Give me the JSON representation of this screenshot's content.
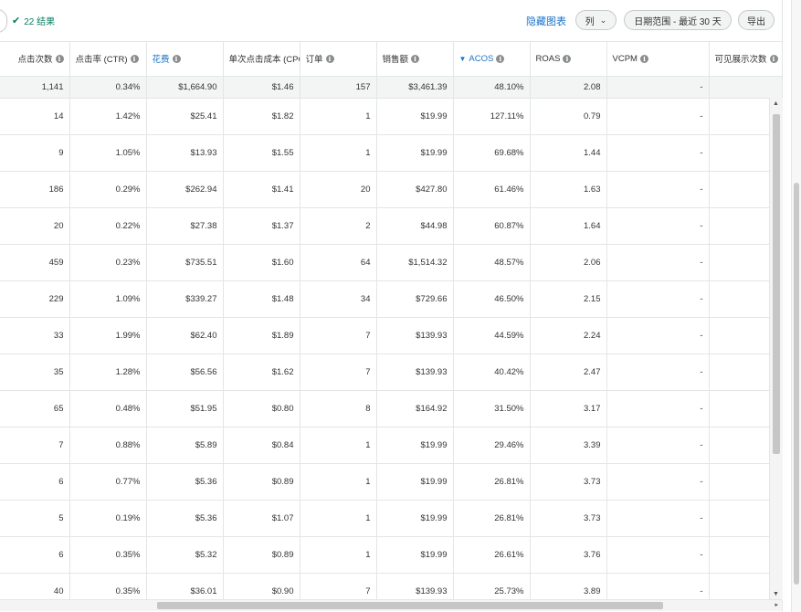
{
  "toolbar": {
    "results_text": "22 结果",
    "hide_chart": "隐藏图表",
    "columns_label": "列",
    "date_range_label": "日期范围 - 最近 30 天",
    "export_label": "导出"
  },
  "columns": [
    {
      "label": "点击次数"
    },
    {
      "label": "点击率 (CTR)"
    },
    {
      "label": "花费"
    },
    {
      "label": "单次点击成本 (CPC)"
    },
    {
      "label": "订单"
    },
    {
      "label": "销售额"
    },
    {
      "label": "ACOS"
    },
    {
      "label": "ROAS"
    },
    {
      "label": "VCPM"
    },
    {
      "label": "可见展示次数"
    }
  ],
  "totals": {
    "clicks": "1,141",
    "ctr": "0.34%",
    "spend": "$1,664.90",
    "cpc": "$1.46",
    "orders": "157",
    "sales": "$3,461.39",
    "acos": "48.10%",
    "roas": "2.08",
    "vcpm": "-",
    "vimp": ""
  },
  "rows": [
    {
      "clicks": "14",
      "ctr": "1.42%",
      "spend": "$25.41",
      "cpc": "$1.82",
      "orders": "1",
      "sales": "$19.99",
      "acos": "127.11%",
      "roas": "0.79",
      "vcpm": "-"
    },
    {
      "clicks": "9",
      "ctr": "1.05%",
      "spend": "$13.93",
      "cpc": "$1.55",
      "orders": "1",
      "sales": "$19.99",
      "acos": "69.68%",
      "roas": "1.44",
      "vcpm": "-"
    },
    {
      "clicks": "186",
      "ctr": "0.29%",
      "spend": "$262.94",
      "cpc": "$1.41",
      "orders": "20",
      "sales": "$427.80",
      "acos": "61.46%",
      "roas": "1.63",
      "vcpm": "-"
    },
    {
      "clicks": "20",
      "ctr": "0.22%",
      "spend": "$27.38",
      "cpc": "$1.37",
      "orders": "2",
      "sales": "$44.98",
      "acos": "60.87%",
      "roas": "1.64",
      "vcpm": "-"
    },
    {
      "clicks": "459",
      "ctr": "0.23%",
      "spend": "$735.51",
      "cpc": "$1.60",
      "orders": "64",
      "sales": "$1,514.32",
      "acos": "48.57%",
      "roas": "2.06",
      "vcpm": "-"
    },
    {
      "clicks": "229",
      "ctr": "1.09%",
      "spend": "$339.27",
      "cpc": "$1.48",
      "orders": "34",
      "sales": "$729.66",
      "acos": "46.50%",
      "roas": "2.15",
      "vcpm": "-"
    },
    {
      "clicks": "33",
      "ctr": "1.99%",
      "spend": "$62.40",
      "cpc": "$1.89",
      "orders": "7",
      "sales": "$139.93",
      "acos": "44.59%",
      "roas": "2.24",
      "vcpm": "-"
    },
    {
      "clicks": "35",
      "ctr": "1.28%",
      "spend": "$56.56",
      "cpc": "$1.62",
      "orders": "7",
      "sales": "$139.93",
      "acos": "40.42%",
      "roas": "2.47",
      "vcpm": "-"
    },
    {
      "clicks": "65",
      "ctr": "0.48%",
      "spend": "$51.95",
      "cpc": "$0.80",
      "orders": "8",
      "sales": "$164.92",
      "acos": "31.50%",
      "roas": "3.17",
      "vcpm": "-"
    },
    {
      "clicks": "7",
      "ctr": "0.88%",
      "spend": "$5.89",
      "cpc": "$0.84",
      "orders": "1",
      "sales": "$19.99",
      "acos": "29.46%",
      "roas": "3.39",
      "vcpm": "-"
    },
    {
      "clicks": "6",
      "ctr": "0.77%",
      "spend": "$5.36",
      "cpc": "$0.89",
      "orders": "1",
      "sales": "$19.99",
      "acos": "26.81%",
      "roas": "3.73",
      "vcpm": "-"
    },
    {
      "clicks": "5",
      "ctr": "0.19%",
      "spend": "$5.36",
      "cpc": "$1.07",
      "orders": "1",
      "sales": "$19.99",
      "acos": "26.81%",
      "roas": "3.73",
      "vcpm": "-"
    },
    {
      "clicks": "6",
      "ctr": "0.35%",
      "spend": "$5.32",
      "cpc": "$0.89",
      "orders": "1",
      "sales": "$19.99",
      "acos": "26.61%",
      "roas": "3.76",
      "vcpm": "-"
    },
    {
      "clicks": "40",
      "ctr": "0.35%",
      "spend": "$36.01",
      "cpc": "$0.90",
      "orders": "7",
      "sales": "$139.93",
      "acos": "25.73%",
      "roas": "3.89",
      "vcpm": "-"
    }
  ],
  "icons": {
    "check": "check-icon",
    "info": "info-icon",
    "sort_desc": "sort-descending-icon",
    "chevron": "chevron-down-icon"
  },
  "colors": {
    "accent": "#1a73c8",
    "success": "#067d62",
    "totals_bg": "#f3f4f4",
    "border": "#e3e6e6"
  }
}
